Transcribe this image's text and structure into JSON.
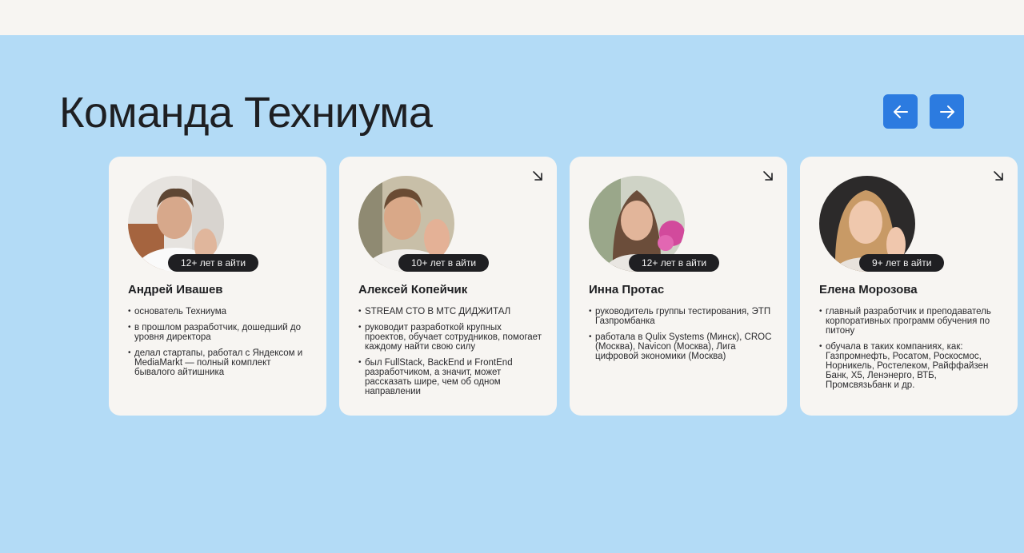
{
  "page": {
    "title": "Команда Техниума"
  },
  "nav": {
    "prev_icon": "arrow-left-icon",
    "next_icon": "arrow-right-icon",
    "accent": "#2c7be0"
  },
  "team": [
    {
      "name": "Андрей Ивашев",
      "experience": "12+ лет в айти",
      "facts": [
        "основатель Техниума",
        "в прошлом разработчик, дошедший до уровня директора",
        "делал стартапы, работал с Яндексом и MediaMarkt — полный комплект бывалого айтишника"
      ]
    },
    {
      "name": "Алексей Копейчик",
      "experience": "10+ лет в айти",
      "facts": [
        "STREAM CTO В МТС ДИДЖИТАЛ",
        "руководит разработкой крупных проектов, обучает сотрудников, помогает каждому найти свою силу",
        "был FullStack, BackEnd и FrontEnd разработчиком, а значит, может рассказать шире, чем об одном направлении"
      ]
    },
    {
      "name": "Инна Протас",
      "experience": "12+ лет в айти",
      "facts": [
        "руководитель группы тестирования, ЭТП Газпромбанка",
        "работала в Qulix Systems (Минск), CROC (Москва), Navicon (Москва), Лига цифровой экономики (Москва)"
      ]
    },
    {
      "name": "Елена Морозова",
      "experience": "9+ лет в айти",
      "facts": [
        "главный разработчик и преподаватель корпоративных программ обучения по питону",
        "обучала в таких компаниях, как: Газпромнефть, Росатом, Роскосмос, Норникель, Ростелеком, Райффайзен Банк, X5, Ленэнерго, ВТБ, Промсвязьбанк и др."
      ]
    }
  ]
}
